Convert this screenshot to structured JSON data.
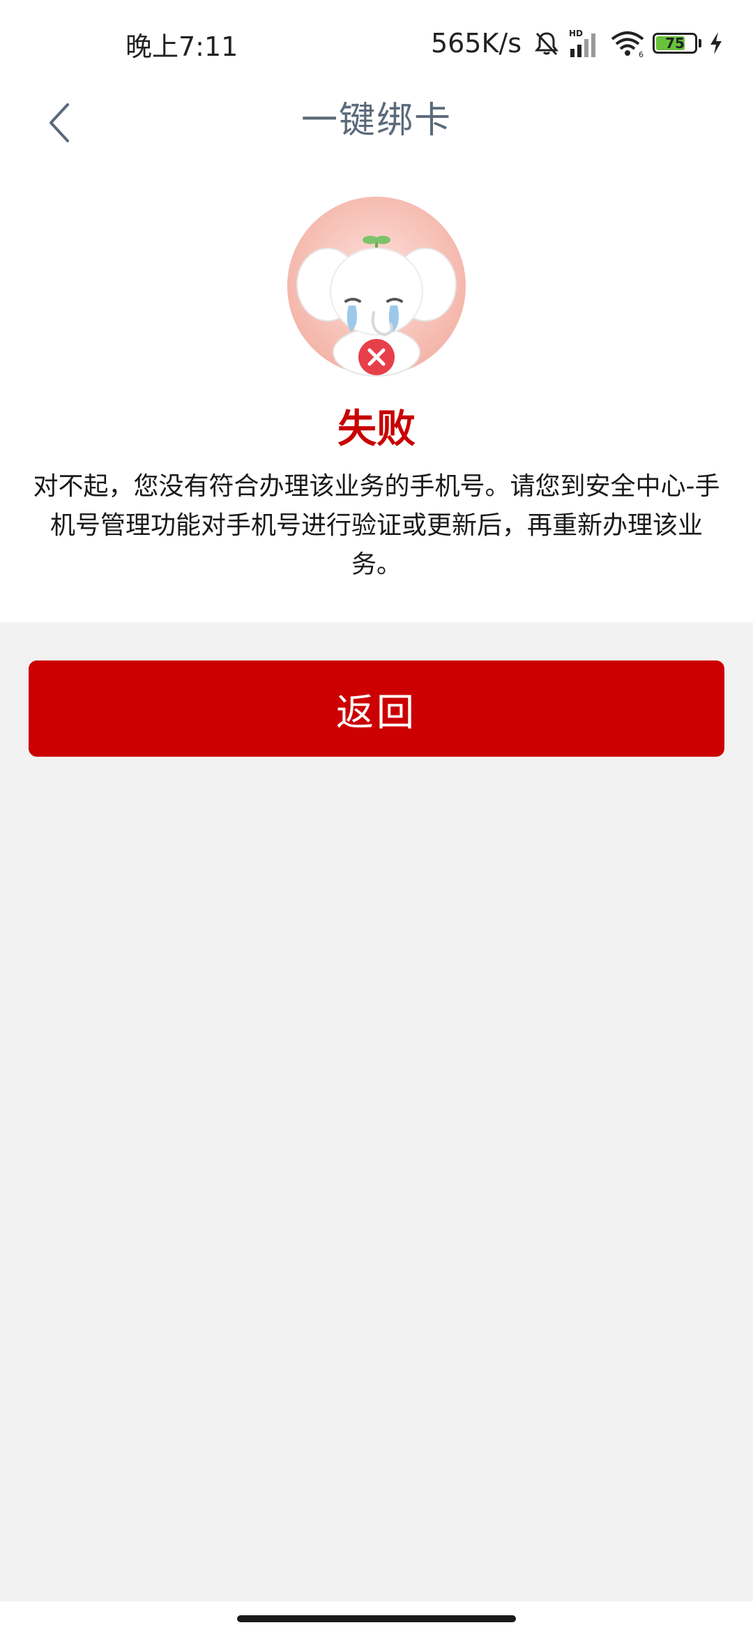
{
  "status_bar": {
    "time": "晚上7:11",
    "net_speed": "565K/s",
    "network_label": "HD",
    "battery_level": "75",
    "battery_fraction": 0.75,
    "battery_color": "#67c23a",
    "icons": [
      "mute-icon",
      "signal-icon",
      "wifi-icon",
      "battery-icon",
      "charging-icon"
    ]
  },
  "header": {
    "title": "一键绑卡",
    "back_icon": "chevron-left-icon",
    "title_color": "#5a6a7a"
  },
  "result": {
    "title": "失败",
    "title_color": "#c80000",
    "message": "对不起，您没有符合办理该业务的手机号。请您到安全中心-手机号管理功能对手机号进行验证或更新后，再重新办理该业务。",
    "mascot_icon": "crying-elephant-mascot-icon",
    "status_icon": "x-circle-icon"
  },
  "actions": {
    "return_label": "返回",
    "button_color": "#cc0000"
  }
}
